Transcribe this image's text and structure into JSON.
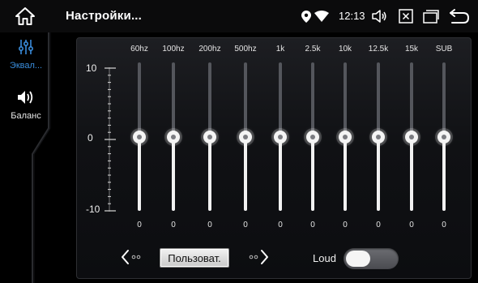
{
  "header": {
    "title": "Настройки...",
    "clock": "12:13"
  },
  "sidebar": {
    "items": [
      {
        "label": "Эквал...",
        "icon": "equalizer-sliders-icon",
        "active": true
      },
      {
        "label": "Баланс",
        "icon": "speaker-volume-icon",
        "active": false
      }
    ]
  },
  "equalizer": {
    "scale": {
      "top": "10",
      "middle": "0",
      "bottom": "-10"
    },
    "bands": [
      {
        "freq": "60hz",
        "value": "0"
      },
      {
        "freq": "100hz",
        "value": "0"
      },
      {
        "freq": "200hz",
        "value": "0"
      },
      {
        "freq": "500hz",
        "value": "0"
      },
      {
        "freq": "1k",
        "value": "0"
      },
      {
        "freq": "2.5k",
        "value": "0"
      },
      {
        "freq": "10k",
        "value": "0"
      },
      {
        "freq": "12.5k",
        "value": "0"
      },
      {
        "freq": "15k",
        "value": "0"
      },
      {
        "freq": "SUB",
        "value": "0"
      }
    ],
    "range": [
      -10,
      10
    ]
  },
  "controls": {
    "preset_label": "Пользоват.",
    "loud_label": "Loud",
    "loud_on": false
  },
  "colors": {
    "accent": "#3a8ddc",
    "background": "#000000"
  }
}
